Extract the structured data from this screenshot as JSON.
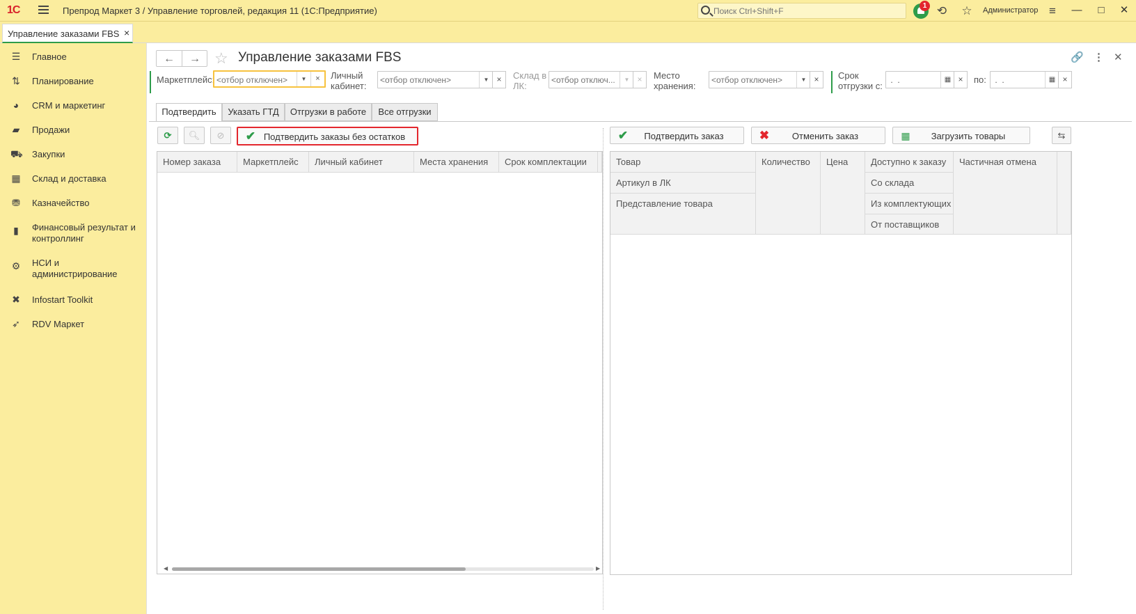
{
  "titlebar": {
    "logo": "1С",
    "app_title": "Препрод Маркет 3 / Управление торговлей, редакция 11  (1С:Предприятие)",
    "search_placeholder": "Поиск Ctrl+Shift+F",
    "notifications_count": "1",
    "user": "Администратор"
  },
  "open_tab": {
    "label": "Управление заказами FBS",
    "close": "×"
  },
  "sidebar": {
    "items": [
      {
        "label": "Главное"
      },
      {
        "label": "Планирование"
      },
      {
        "label": "CRM и маркетинг"
      },
      {
        "label": "Продажи"
      },
      {
        "label": "Закупки"
      },
      {
        "label": "Склад и доставка"
      },
      {
        "label": "Казначейство"
      },
      {
        "label": "Финансовый результат и контроллинг"
      },
      {
        "label": "НСИ и администрирование"
      },
      {
        "label": "Infostart Toolkit"
      },
      {
        "label": "RDV Маркет"
      }
    ]
  },
  "page": {
    "title": "Управление заказами FBS"
  },
  "filters": {
    "marketplace_label": "Маркетплейс:",
    "cabinet_label_1": "Личный",
    "cabinet_label_2": "кабинет:",
    "warehouse_lk_label_1": "Склад в",
    "warehouse_lk_label_2": "ЛК:",
    "storage_label_1": "Место",
    "storage_label_2": "хранения:",
    "period_label_1": "Срок",
    "period_label_2": "отгрузки с:",
    "to_label": "по:",
    "placeholder_off": "<отбор отключен>",
    "placeholder_off_short": "<отбор отключ...",
    "date_placeholder": " .  ."
  },
  "tabs": [
    {
      "label": "Подтвердить"
    },
    {
      "label": "Указать ГТД"
    },
    {
      "label": "Отгрузки в работе"
    },
    {
      "label": "Все отгрузки"
    }
  ],
  "left_panel": {
    "confirm_no_stock_button": "Подтвердить заказы без остатков",
    "columns": [
      "Номер заказа",
      "Маркетплейс",
      "Личный кабинет",
      "Места хранения",
      "Срок комплектации"
    ]
  },
  "right_panel": {
    "confirm_order_button": "Подтвердить заказ",
    "cancel_order_button": "Отменить заказ",
    "load_goods_button": "Загрузить товары",
    "columns": {
      "product": "Товар",
      "article": "Артикул в ЛК",
      "product_view": "Представление товара",
      "quantity": "Количество",
      "price": "Цена",
      "available": "Доступно к заказу",
      "from_warehouse": "Со склада",
      "from_components": "Из комплектующих",
      "from_suppliers": "От поставщиков",
      "partial_cancel": "Частичная отмена"
    }
  },
  "colors": {
    "sidebar_bg": "#fbed9e",
    "accent_green": "#2e9c4a",
    "accent_red": "#e3262d",
    "active_field_border": "#f7c23e"
  }
}
